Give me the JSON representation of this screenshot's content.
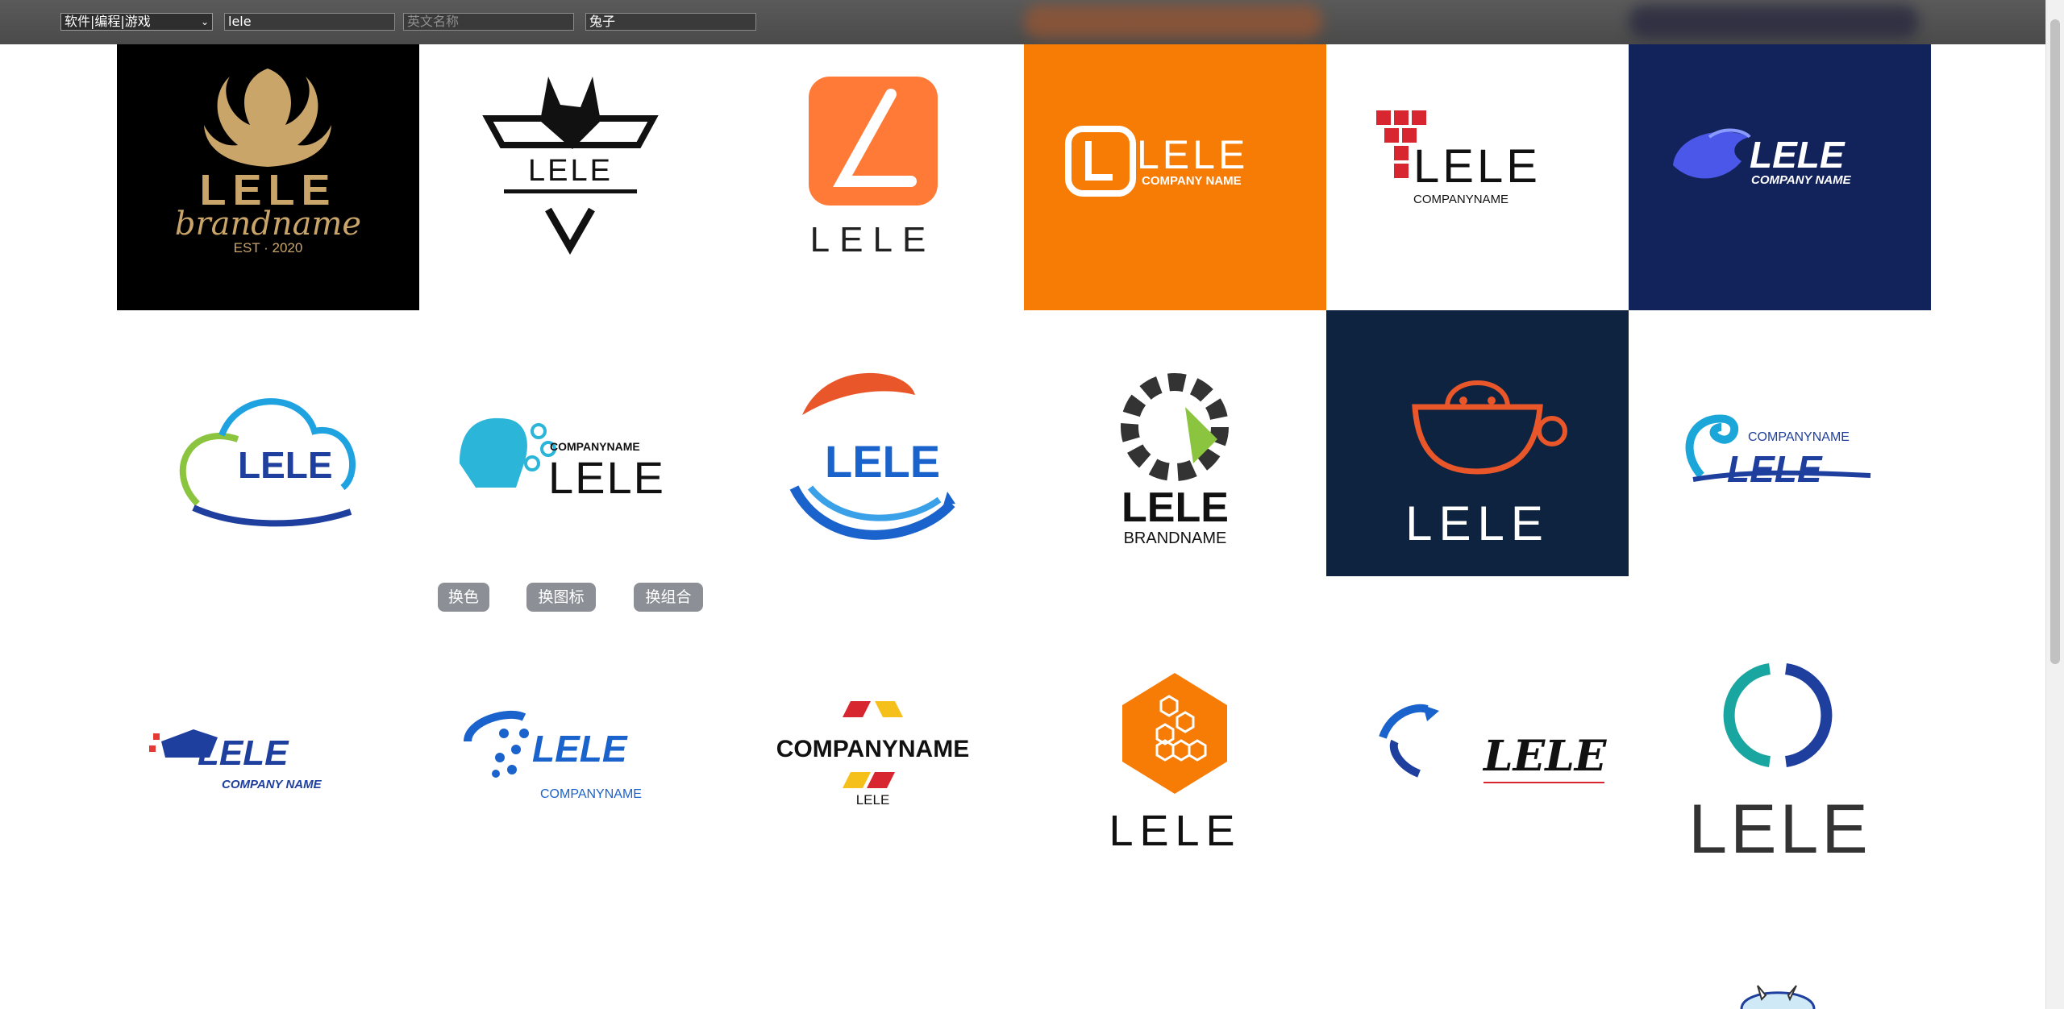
{
  "toolbar": {
    "category_select": "软件|编程|游戏",
    "keyword_value": "lele",
    "english_name_placeholder": "英文名称",
    "mascot_value": "兔子"
  },
  "buttons": {
    "change_color": "换色",
    "change_icon": "换图标",
    "change_combo": "换组合"
  },
  "logos": {
    "phoenix": {
      "name": "LELE",
      "sub": "brandname",
      "est": "EST · 2020",
      "bg": "#000000",
      "color": "#c9a56a"
    },
    "wolf": {
      "name": "LELE"
    },
    "square_l": {
      "name": "LELE",
      "color": "#ff7a36"
    },
    "orange_l": {
      "name": "LELE",
      "sub": "COMPANY NAME",
      "bg": "#f77c05"
    },
    "red_pixel": {
      "name": "LELE",
      "sub": "COMPANYNAME"
    },
    "navy_wave": {
      "name": "LELE",
      "sub": "COMPANY NAME",
      "bg": "#12225a"
    },
    "cloud": {
      "name": "LELE"
    },
    "ai_head": {
      "name": "LELE",
      "sub": "COMPANYNAME"
    },
    "globe_swoosh": {
      "name": "LELE"
    },
    "gear": {
      "name": "LELE",
      "sub": "BRANDNAME"
    },
    "cup_monster": {
      "name": "LELE",
      "bg": "#0d2340"
    },
    "blue_swirl": {
      "name": "LELE",
      "sub": "COMPANYNAME"
    },
    "bull": {
      "name": "LELE",
      "sub": "COMPANY NAME"
    },
    "dot_globe": {
      "name": "LELE",
      "sub": "COMPANYNAME"
    },
    "diamond": {
      "name": "COMPANYNAME",
      "sub": "LELE"
    },
    "hex_honey": {
      "name": "LELE"
    },
    "arrows": {
      "name": "LELE"
    },
    "ring": {
      "name": "LELE"
    }
  },
  "colors": {
    "accent_orange": "#f77c05",
    "navy": "#12225a",
    "dark_navy": "#0d2340"
  }
}
